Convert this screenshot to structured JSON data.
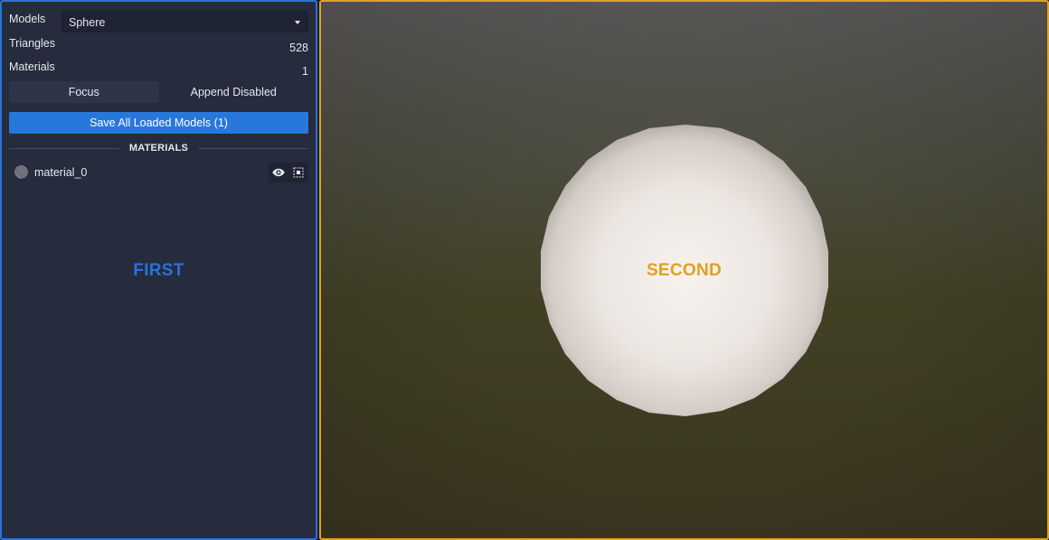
{
  "models": {
    "label": "Models",
    "selected": "Sphere"
  },
  "stats": {
    "triangles_label": "Triangles",
    "triangles_value": "528",
    "materials_label": "Materials",
    "materials_value": "1"
  },
  "actions": {
    "focus_label": "Focus",
    "append_label": "Append Disabled",
    "save_label": "Save All Loaded Models (1)"
  },
  "materials_section": {
    "heading": "MATERIALS",
    "items": [
      {
        "name": "material_0",
        "visible_icon": "eye-icon",
        "select_icon": "select-icon"
      }
    ]
  },
  "overlays": {
    "first": "FIRST",
    "second": "SECOND"
  },
  "colors": {
    "accent_blue": "#2a72d8",
    "accent_orange": "#e0a020",
    "panel_bg": "#262b3d",
    "button_primary": "#2878db"
  }
}
